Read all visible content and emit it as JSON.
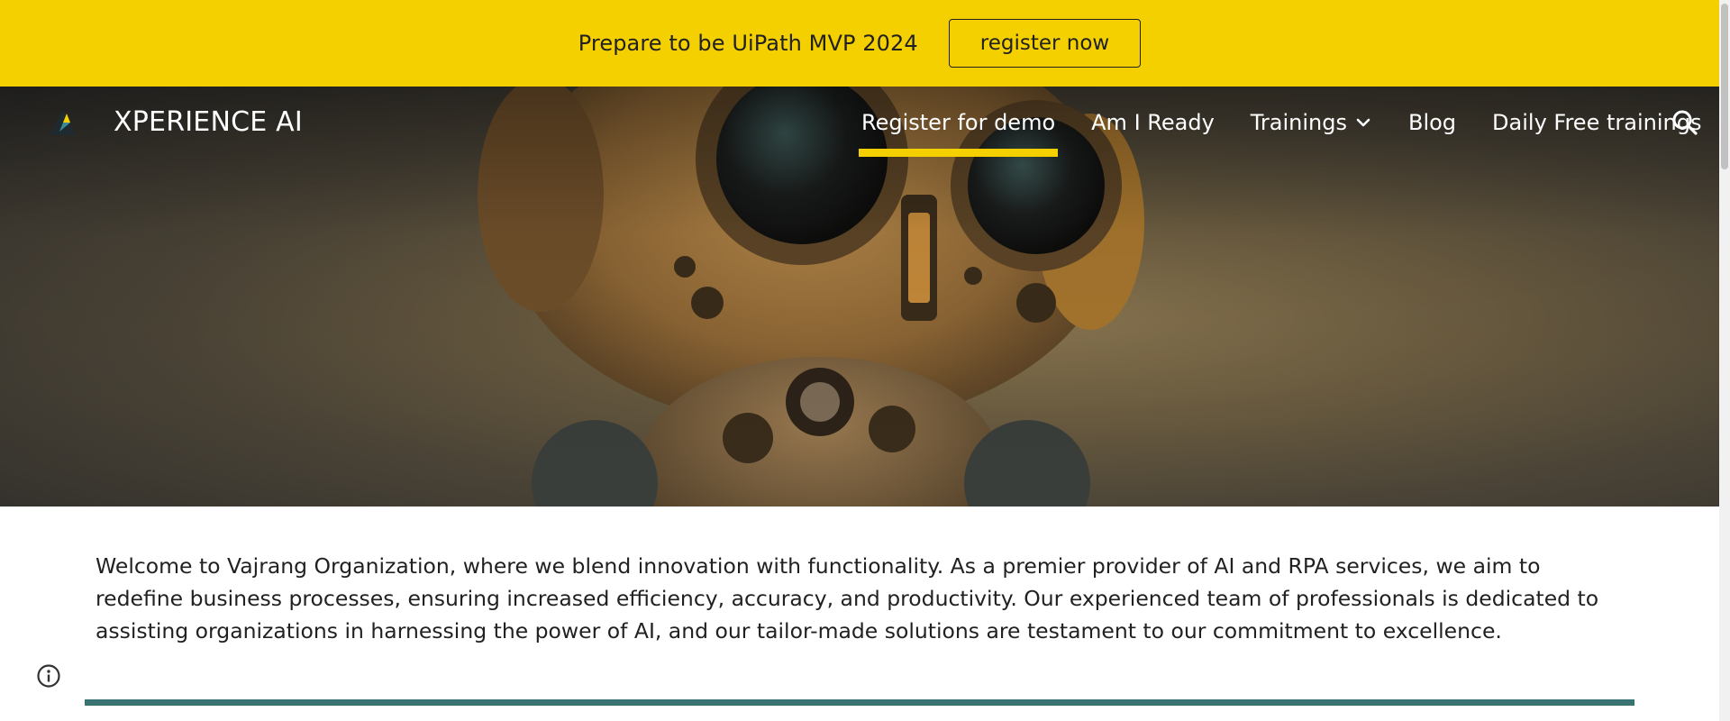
{
  "banner": {
    "text": "Prepare to be UiPath MVP 2024",
    "button_label": "register now"
  },
  "site": {
    "title": "XPERIENCE AI"
  },
  "nav": {
    "items": [
      {
        "label": "Register for demo",
        "active": true
      },
      {
        "label": "Am I Ready"
      },
      {
        "label": "Trainings",
        "has_dropdown": true
      },
      {
        "label": "Blog"
      },
      {
        "label": "Daily Free trainings"
      }
    ]
  },
  "main": {
    "intro": "Welcome to Vajrang Organization, where we blend innovation with functionality. As a premier provider of AI and RPA services, we aim to redefine business processes, ensuring increased efficiency, accuracy, and productivity. Our experienced team of professionals is dedicated to assisting organizations in harnessing the power of AI, and our tailor-made solutions are testament to our commitment to excellence."
  },
  "icons": {
    "search": "search-icon",
    "info": "info-icon",
    "chevron": "chevron-down-icon",
    "logo": "logo-icon"
  },
  "colors": {
    "banner_bg": "#f5d000",
    "active_underline": "#f5d000",
    "divider": "#3a7472"
  }
}
